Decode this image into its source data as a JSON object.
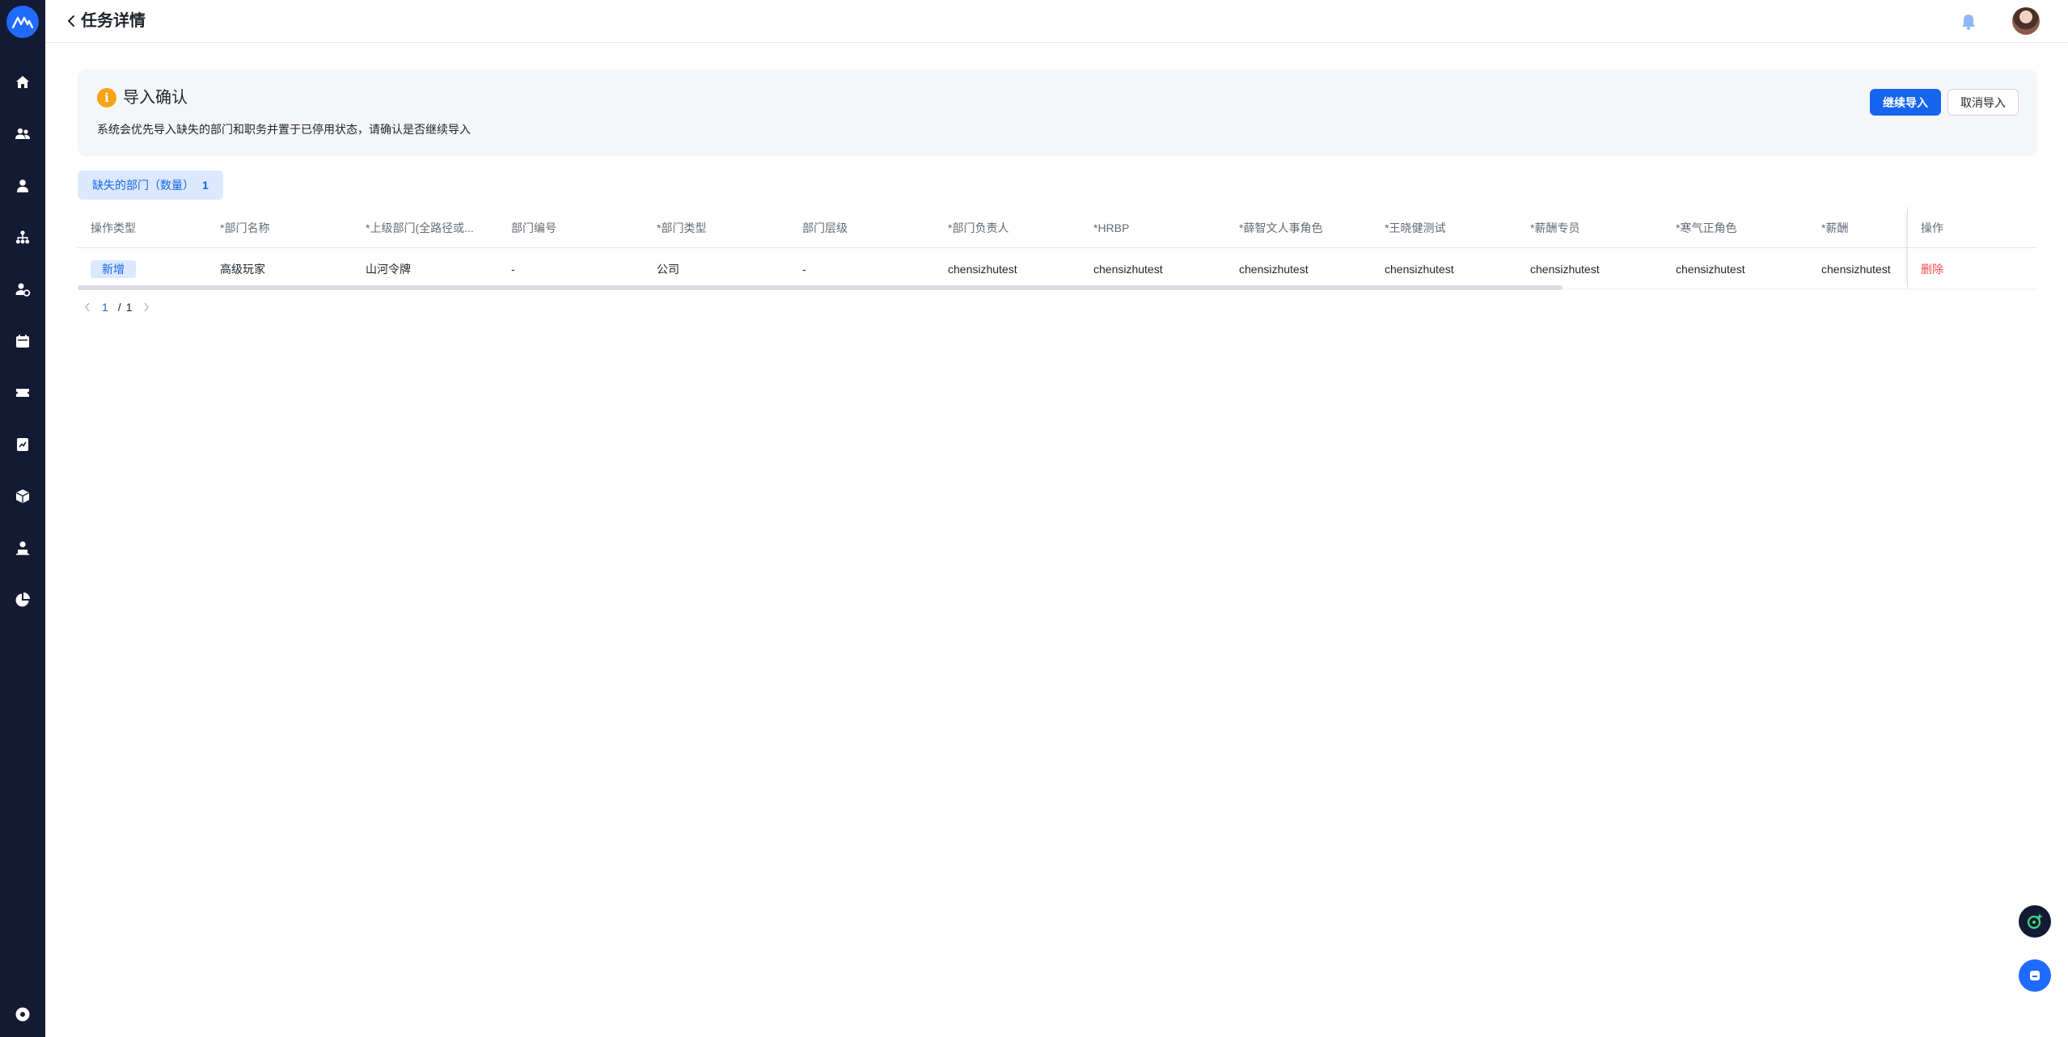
{
  "header": {
    "title": "任务详情"
  },
  "sidebar": {
    "items": [
      {
        "icon": "home-icon"
      },
      {
        "icon": "team-icon"
      },
      {
        "icon": "person-icon"
      },
      {
        "icon": "org-chart-icon"
      },
      {
        "icon": "user-settings-icon"
      },
      {
        "icon": "calendar-icon"
      },
      {
        "icon": "ticket-icon"
      },
      {
        "icon": "report-icon"
      },
      {
        "icon": "cube-icon"
      },
      {
        "icon": "user-badge-icon"
      },
      {
        "icon": "pie-chart-icon"
      }
    ],
    "bottom_icon": "settings-icon"
  },
  "confirm": {
    "title": "导入确认",
    "description": "系统会优先导入缺失的部门和职务并置于已停用状态，请确认是否继续导入",
    "continue_label": "继续导入",
    "cancel_label": "取消导入"
  },
  "tab": {
    "label": "缺失的部门（数量）",
    "count": "1"
  },
  "table": {
    "columns": [
      "操作类型",
      "*部门名称",
      "*上级部门(全路径或...",
      "部门编号",
      "*部门类型",
      "部门层级",
      "*部门负责人",
      "*HRBP",
      "*薛智文人事角色",
      "*王晓健测试",
      "*薪酬专员",
      "*寒气正角色",
      "*薪酬"
    ],
    "op_column": "操作",
    "rows": [
      {
        "cells": [
          "新增",
          "高级玩家",
          "山河令牌",
          "-",
          "公司",
          "-",
          "chensizhutest",
          "chensizhutest",
          "chensizhutest",
          "chensizhutest",
          "chensizhutest",
          "chensizhutest",
          "chensizhutest"
        ],
        "delete_label": "删除"
      }
    ]
  },
  "pagination": {
    "current": "1",
    "separator": "/",
    "total": "1"
  },
  "colors": {
    "sidebar_bg": "#141a33",
    "primary": "#1565f0",
    "warning": "#f5a317",
    "danger": "#f54a45"
  }
}
